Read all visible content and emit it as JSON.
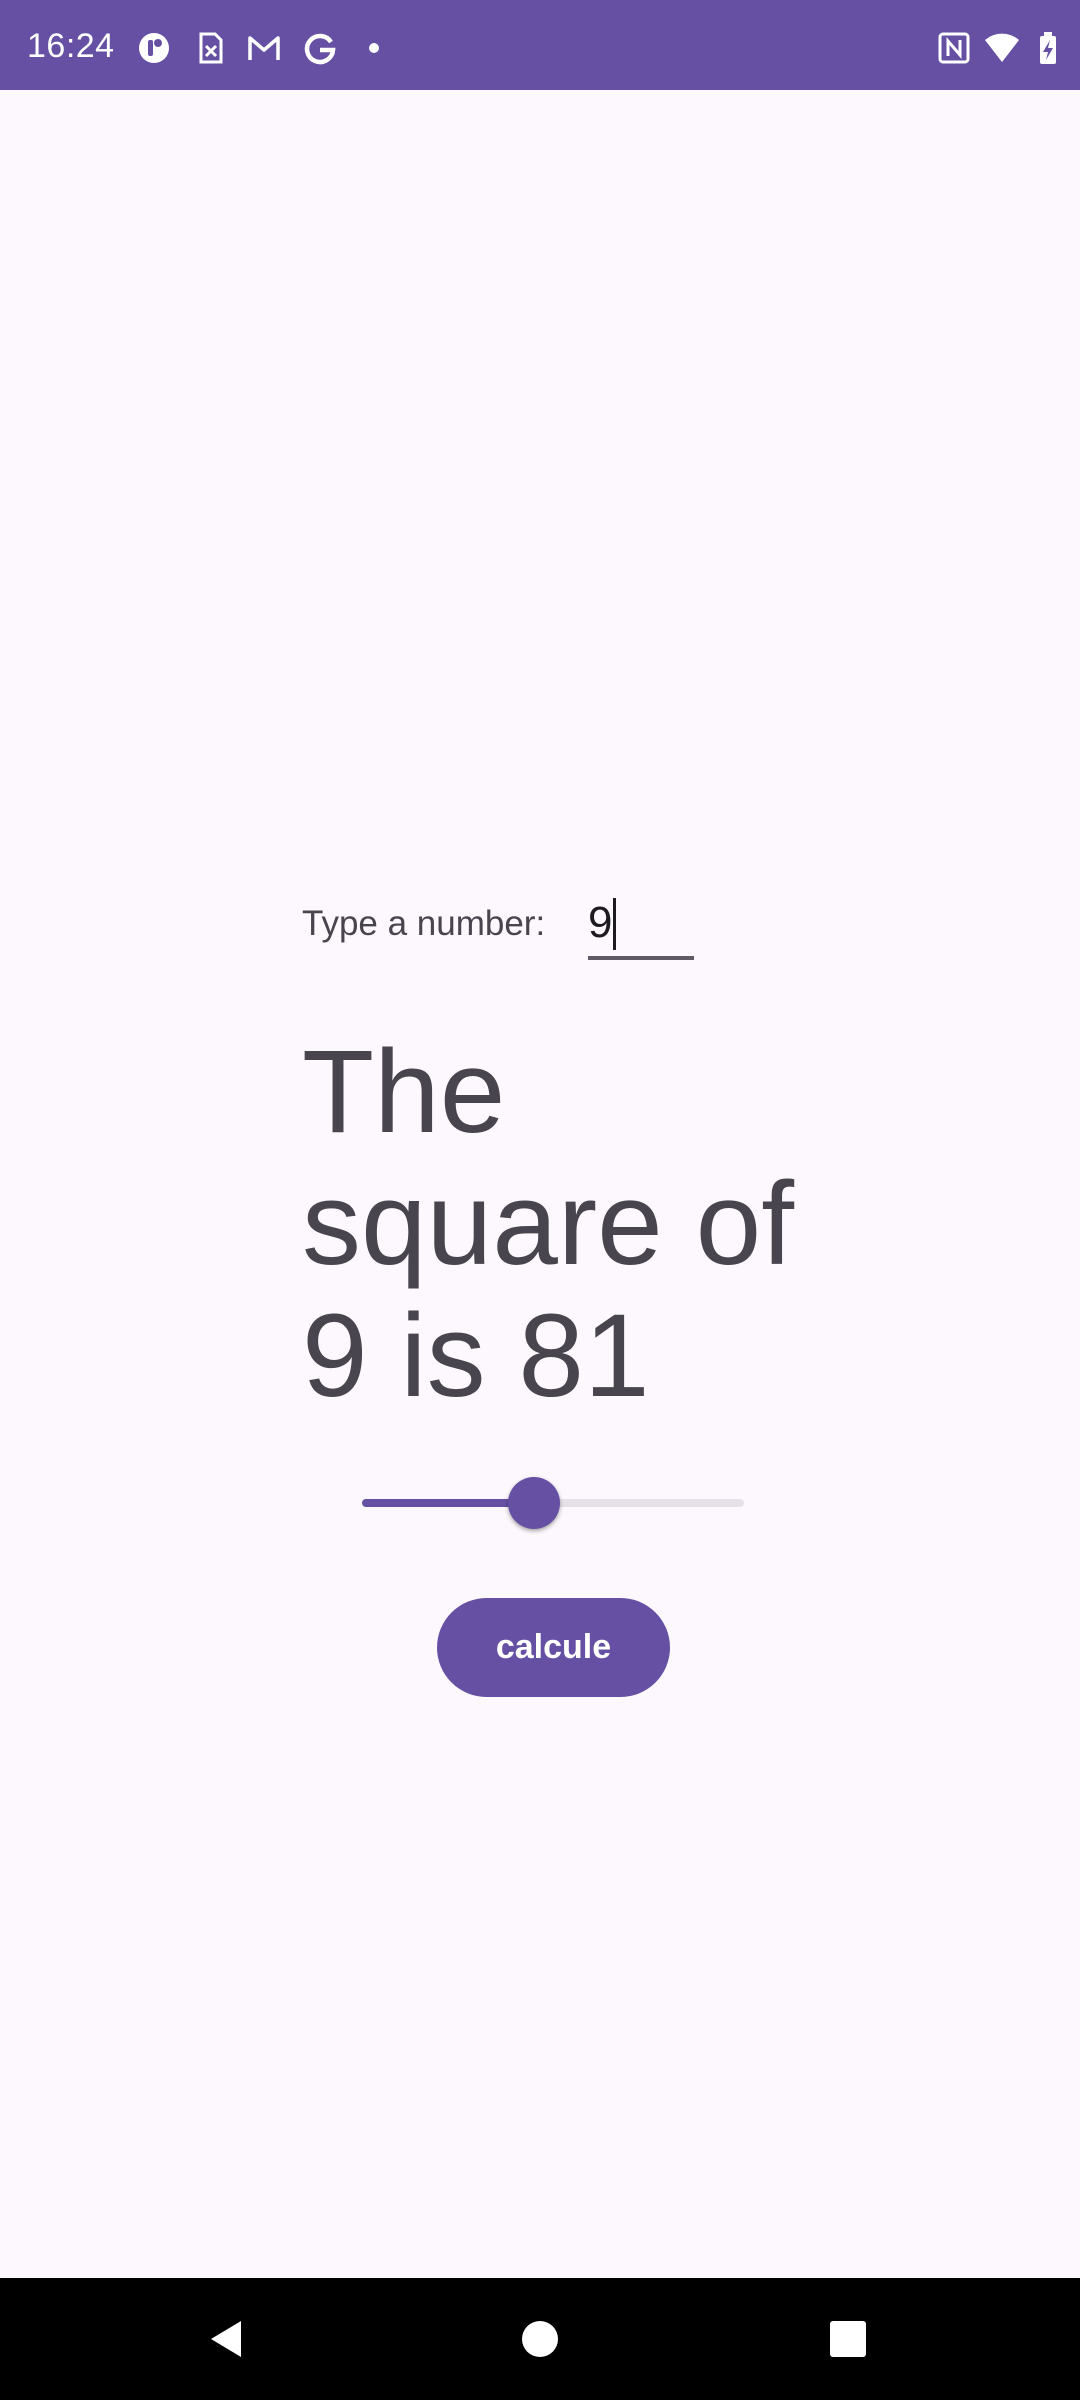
{
  "status_bar": {
    "time": "16:24",
    "color": "#6650a4",
    "left_icons": [
      "app-ring-icon",
      "sim-card-x-icon",
      "gmail-icon",
      "google-icon",
      "notification-dot-icon"
    ],
    "right_icons": [
      "nfc-icon",
      "wifi-icon",
      "battery-charging-icon"
    ]
  },
  "form": {
    "prompt_label": "Type a number:",
    "input_value": "9"
  },
  "result": {
    "text": "The square of 9 is 81"
  },
  "slider": {
    "value": 0.45
  },
  "actions": {
    "calculate_label": "calcule"
  },
  "nav_bar": {
    "icons": [
      "back-icon",
      "home-icon",
      "recents-icon"
    ]
  },
  "colors": {
    "accent": "#6650a4",
    "background": "#fdf8fd",
    "text": "#49454f"
  }
}
